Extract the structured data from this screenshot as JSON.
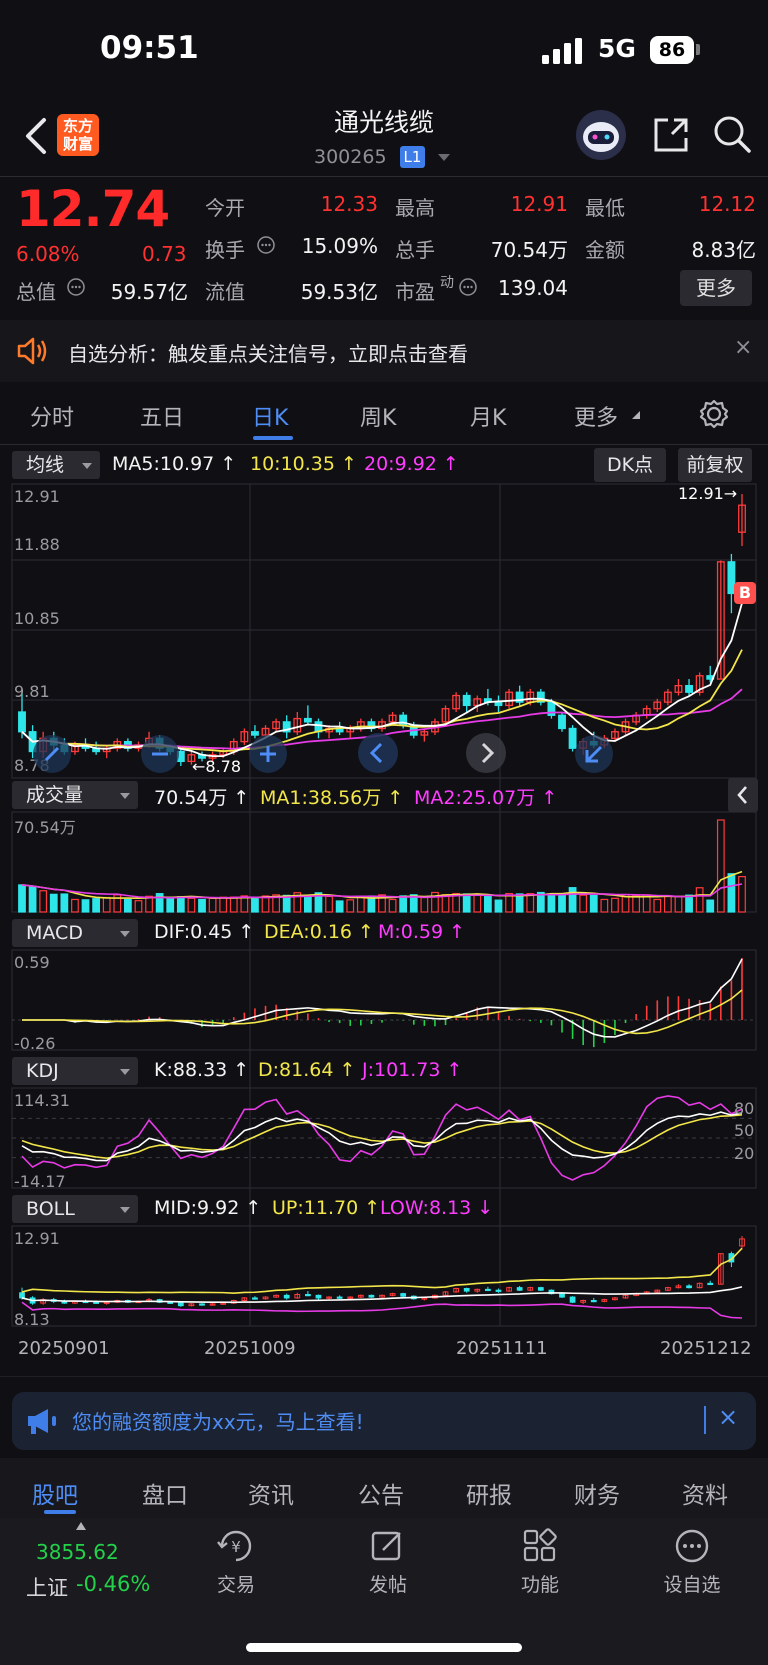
{
  "status_bar": {
    "time": "09:51",
    "network": "5G",
    "battery": "86"
  },
  "header": {
    "logo_text": "东方财富",
    "stock_name": "通光线缆",
    "stock_code": "300265",
    "level_badge": "L1"
  },
  "quote": {
    "price": "12.74",
    "change_pct": "6.08%",
    "change_amt": "0.73",
    "fields": [
      {
        "label": "今开",
        "value": "12.33",
        "color": "red"
      },
      {
        "label": "最高",
        "value": "12.91",
        "color": "red"
      },
      {
        "label": "最低",
        "value": "12.12",
        "color": "red"
      },
      {
        "label": "换手",
        "value": "15.09%"
      },
      {
        "label": "总手",
        "value": "70.54万"
      },
      {
        "label": "金额",
        "value": "8.83亿"
      },
      {
        "label": "总值",
        "value": "59.57亿"
      },
      {
        "label": "流值",
        "value": "59.53亿"
      },
      {
        "label": "市盈",
        "label_sup": "动",
        "value": "139.04"
      }
    ],
    "more_label": "更多"
  },
  "alert": {
    "text": "自选分析：触发重点关注信号，立即点击查看",
    "close": "×"
  },
  "tabs": [
    "分时",
    "五日",
    "日K",
    "周K",
    "月K",
    "更多"
  ],
  "active_tab": "日K",
  "kline": {
    "ma_select": "均线",
    "ma5": "MA5:10.97 ↑",
    "ma10": "10:10.35 ↑",
    "ma20": "20:9.92 ↑",
    "dk_label": "DK点",
    "adjust_label": "前复权",
    "y_labels": [
      "12.91",
      "11.88",
      "10.85",
      "9.81",
      "8.78"
    ],
    "high_marker": "12.91→",
    "low_marker": "←8.78",
    "buy_marker": "B"
  },
  "volume": {
    "select": "成交量",
    "value": "70.54万 ↑",
    "ma1": "MA1:38.56万 ↑",
    "ma2": "MA2:25.07万 ↑",
    "y_label": "70.54万"
  },
  "macd": {
    "select": "MACD",
    "dif": "DIF:0.45 ↑",
    "dea": "DEA:0.16 ↑",
    "m": "M:0.59 ↑",
    "y_top": "0.59",
    "y_bottom": "-0.26"
  },
  "kdj": {
    "select": "KDJ",
    "k": "K:88.33 ↑",
    "d": "D:81.64 ↑",
    "j": "J:101.73 ↑",
    "y_top": "114.31",
    "y_bottom": "-14.17",
    "levels": [
      "80",
      "50",
      "20"
    ]
  },
  "boll": {
    "select": "BOLL",
    "mid": "MID:9.92 ↑",
    "up": "UP:11.70 ↑",
    "low": "LOW:8.13 ↓",
    "y_top": "12.91",
    "y_bottom": "8.13"
  },
  "dates": [
    "20250901",
    "20251009",
    "20251111",
    "20251212"
  ],
  "promo": {
    "text": "您的融资额度为xx元，马上查看!",
    "close": "×"
  },
  "bottom_tabs": [
    "股吧",
    "盘口",
    "资讯",
    "公告",
    "研报",
    "财务",
    "资料"
  ],
  "footer": {
    "index_value": "3855.62",
    "index_name": "上证",
    "index_change": "-0.46%",
    "items": [
      "交易",
      "发帖",
      "功能",
      "设自选"
    ]
  },
  "chart_data": {
    "type": "candlestick",
    "title": "",
    "x": [
      "20250901",
      "20251009",
      "20251111",
      "20251212"
    ],
    "ylim": [
      8.78,
      12.91
    ],
    "series": [
      {
        "name": "MA5",
        "values": [
          10.97
        ]
      },
      {
        "name": "MA10",
        "values": [
          10.35
        ]
      },
      {
        "name": "MA20",
        "values": [
          9.92
        ]
      }
    ],
    "candles": [
      [
        9.6,
        9.9,
        9.2,
        9.3
      ],
      [
        9.3,
        9.4,
        8.9,
        9.0
      ],
      [
        9.0,
        9.3,
        8.9,
        9.2
      ],
      [
        9.2,
        9.3,
        9.0,
        9.1
      ],
      [
        9.1,
        9.2,
        8.95,
        9.0
      ],
      [
        9.0,
        9.15,
        8.95,
        9.1
      ],
      [
        9.1,
        9.2,
        9.0,
        9.05
      ],
      [
        9.05,
        9.15,
        8.95,
        9.0
      ],
      [
        9.0,
        9.1,
        8.9,
        9.05
      ],
      [
        9.05,
        9.2,
        9.0,
        9.15
      ],
      [
        9.15,
        9.2,
        9.0,
        9.05
      ],
      [
        9.05,
        9.15,
        9.0,
        9.1
      ],
      [
        9.1,
        9.3,
        9.05,
        9.2
      ],
      [
        9.2,
        9.25,
        9.0,
        9.05
      ],
      [
        9.05,
        9.1,
        8.95,
        9.0
      ],
      [
        9.0,
        9.05,
        8.78,
        8.85
      ],
      [
        8.85,
        9.0,
        8.8,
        8.95
      ],
      [
        8.95,
        9.0,
        8.85,
        8.9
      ],
      [
        8.9,
        9.0,
        8.85,
        8.95
      ],
      [
        8.95,
        9.05,
        8.9,
        9.0
      ],
      [
        9.0,
        9.2,
        8.95,
        9.15
      ],
      [
        9.15,
        9.35,
        9.1,
        9.3
      ],
      [
        9.3,
        9.4,
        9.2,
        9.25
      ],
      [
        9.25,
        9.4,
        9.2,
        9.35
      ],
      [
        9.35,
        9.5,
        9.3,
        9.45
      ],
      [
        9.45,
        9.55,
        9.2,
        9.3
      ],
      [
        9.3,
        9.6,
        9.25,
        9.5
      ],
      [
        9.5,
        9.7,
        9.4,
        9.45
      ],
      [
        9.45,
        9.5,
        9.2,
        9.3
      ],
      [
        9.3,
        9.4,
        9.2,
        9.35
      ],
      [
        9.35,
        9.45,
        9.25,
        9.3
      ],
      [
        9.3,
        9.4,
        9.2,
        9.35
      ],
      [
        9.35,
        9.5,
        9.3,
        9.45
      ],
      [
        9.45,
        9.5,
        9.3,
        9.35
      ],
      [
        9.35,
        9.5,
        9.3,
        9.45
      ],
      [
        9.45,
        9.6,
        9.4,
        9.55
      ],
      [
        9.55,
        9.6,
        9.35,
        9.4
      ],
      [
        9.4,
        9.45,
        9.2,
        9.25
      ],
      [
        9.25,
        9.35,
        9.15,
        9.3
      ],
      [
        9.3,
        9.5,
        9.25,
        9.45
      ],
      [
        9.45,
        9.7,
        9.4,
        9.65
      ],
      [
        9.65,
        9.9,
        9.6,
        9.85
      ],
      [
        9.85,
        9.9,
        9.6,
        9.7
      ],
      [
        9.7,
        9.85,
        9.6,
        9.8
      ],
      [
        9.8,
        9.95,
        9.7,
        9.75
      ],
      [
        9.75,
        9.85,
        9.6,
        9.7
      ],
      [
        9.7,
        9.95,
        9.65,
        9.9
      ],
      [
        9.9,
        10.0,
        9.7,
        9.75
      ],
      [
        9.75,
        9.95,
        9.7,
        9.9
      ],
      [
        9.9,
        9.95,
        9.7,
        9.75
      ],
      [
        9.75,
        9.8,
        9.5,
        9.55
      ],
      [
        9.55,
        9.6,
        9.3,
        9.35
      ],
      [
        9.35,
        9.4,
        9.0,
        9.05
      ],
      [
        9.05,
        9.2,
        8.95,
        9.15
      ],
      [
        9.15,
        9.3,
        9.05,
        9.1
      ],
      [
        9.1,
        9.25,
        9.05,
        9.2
      ],
      [
        9.2,
        9.35,
        9.15,
        9.3
      ],
      [
        9.3,
        9.5,
        9.25,
        9.45
      ],
      [
        9.45,
        9.6,
        9.4,
        9.55
      ],
      [
        9.55,
        9.7,
        9.5,
        9.65
      ],
      [
        9.65,
        9.8,
        9.6,
        9.75
      ],
      [
        9.75,
        9.95,
        9.7,
        9.9
      ],
      [
        9.9,
        10.1,
        9.85,
        10.0
      ],
      [
        10.0,
        10.1,
        9.85,
        9.9
      ],
      [
        9.9,
        10.2,
        9.85,
        10.15
      ],
      [
        10.15,
        10.3,
        10.05,
        10.1
      ],
      [
        10.1,
        11.9,
        10.1,
        11.88
      ],
      [
        11.88,
        12.0,
        11.1,
        11.4
      ],
      [
        12.33,
        12.91,
        12.12,
        12.74
      ]
    ]
  }
}
